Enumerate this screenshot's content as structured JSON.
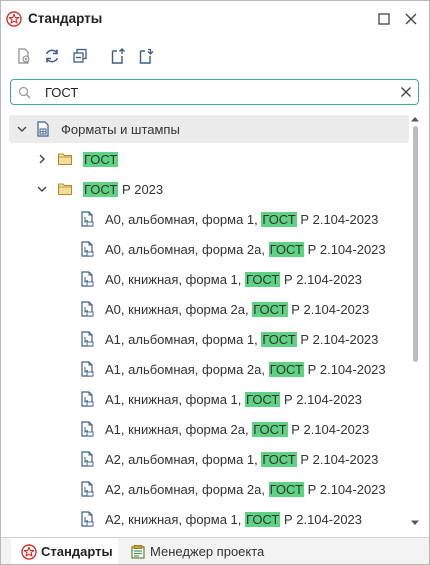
{
  "window": {
    "title": "Стандарты",
    "icons": {
      "app": "standards-app-icon",
      "maximize": "maximize-icon",
      "close": "close-icon"
    }
  },
  "toolbar": {
    "buttons": [
      "new-document-icon",
      "refresh-icon",
      "collapse-all-icon",
      "export-icon",
      "import-icon"
    ]
  },
  "search": {
    "value": "ГОСТ",
    "placeholder": ""
  },
  "tree": {
    "root": {
      "label": "Форматы и штампы",
      "expanded": true
    },
    "folders": [
      {
        "label_hl": "ГОСТ",
        "label_rest": "",
        "expanded": false
      },
      {
        "label_hl": "ГОСТ",
        "label_rest": " Р 2023",
        "expanded": true
      }
    ],
    "items": [
      {
        "pre": "А0, альбомная, форма 1, ",
        "hl": "ГОСТ",
        "post": " Р 2.104-2023"
      },
      {
        "pre": "А0, альбомная, форма 2а, ",
        "hl": "ГОСТ",
        "post": " Р 2.104-2023"
      },
      {
        "pre": "А0, книжная, форма 1, ",
        "hl": "ГОСТ",
        "post": " Р 2.104-2023"
      },
      {
        "pre": "А0, книжная, форма 2а, ",
        "hl": "ГОСТ",
        "post": " Р 2.104-2023"
      },
      {
        "pre": "А1, альбомная, форма 1, ",
        "hl": "ГОСТ",
        "post": " Р 2.104-2023"
      },
      {
        "pre": "А1, альбомная, форма 2а, ",
        "hl": "ГОСТ",
        "post": " Р 2.104-2023"
      },
      {
        "pre": "А1, книжная, форма 1, ",
        "hl": "ГОСТ",
        "post": " Р 2.104-2023"
      },
      {
        "pre": "А1, книжная, форма 2а, ",
        "hl": "ГОСТ",
        "post": " Р 2.104-2023"
      },
      {
        "pre": "А2, альбомная, форма 1, ",
        "hl": "ГОСТ",
        "post": " Р 2.104-2023"
      },
      {
        "pre": "А2, альбомная, форма 2а, ",
        "hl": "ГОСТ",
        "post": " Р 2.104-2023"
      },
      {
        "pre": "А2, книжная, форма 1, ",
        "hl": "ГОСТ",
        "post": " Р 2.104-2023"
      }
    ]
  },
  "tabs": [
    {
      "label": "Стандарты",
      "icon": "standards-tab-icon",
      "active": true
    },
    {
      "label": "Менеджер проекта",
      "icon": "project-manager-icon",
      "active": false
    }
  ],
  "colors": {
    "accent": "#3cae8f",
    "highlight": "#5fd384",
    "brand_red": "#d2322d"
  }
}
